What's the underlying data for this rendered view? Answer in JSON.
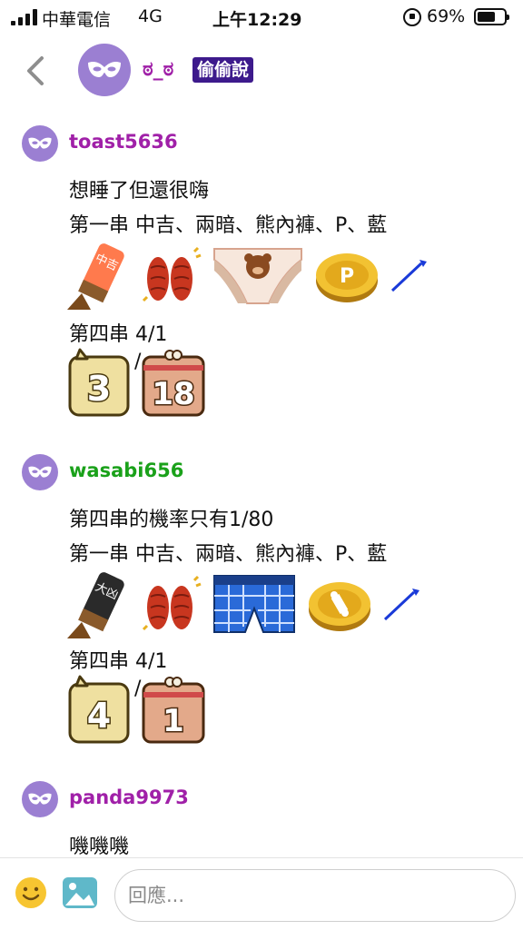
{
  "status_bar": {
    "carrier": "中華電信",
    "network": "4G",
    "time": "上午12:29",
    "battery_percent": "69%",
    "battery_level": 0.69
  },
  "header": {
    "name": "ಠ_ಠ",
    "badge": "偷偷說",
    "name_color": "#a020a8",
    "badge_color": "#3d1a8c"
  },
  "posts": [
    {
      "author": "toast5636",
      "author_color": "#a020a8",
      "lines": [
        "想睡了但還很嗨",
        "第一串 中吉、兩暗、熊內褲、P、藍",
        "第四串 4/1"
      ],
      "sticker_row1": [
        "stick-zhongji-icon",
        "sausage-icon",
        "bear-underwear-icon",
        "coin-p-icon",
        "blue-wand-icon"
      ],
      "stick_text": "中吉",
      "coin_letter": "P",
      "dice": [
        "3",
        "18"
      ],
      "slash": "/"
    },
    {
      "author": "wasabi656",
      "author_color": "#1aa11a",
      "lines": [
        "第四串的機率只有1/80",
        "第一串 中吉、兩暗、熊內褲、P、藍",
        "第四串 4/1"
      ],
      "sticker_row1": [
        "stick-daxiong-icon",
        "sausage-icon",
        "plaid-boxers-icon",
        "coin-bone-icon",
        "blue-wand-icon"
      ],
      "stick_text": "大凶",
      "dice": [
        "4",
        "1"
      ],
      "slash": "/"
    },
    {
      "author": "panda9973",
      "author_color": "#a020a8",
      "lines": [
        "嘰嘰嘰"
      ]
    }
  ],
  "bottom_bar": {
    "reply_placeholder": "回應..."
  }
}
